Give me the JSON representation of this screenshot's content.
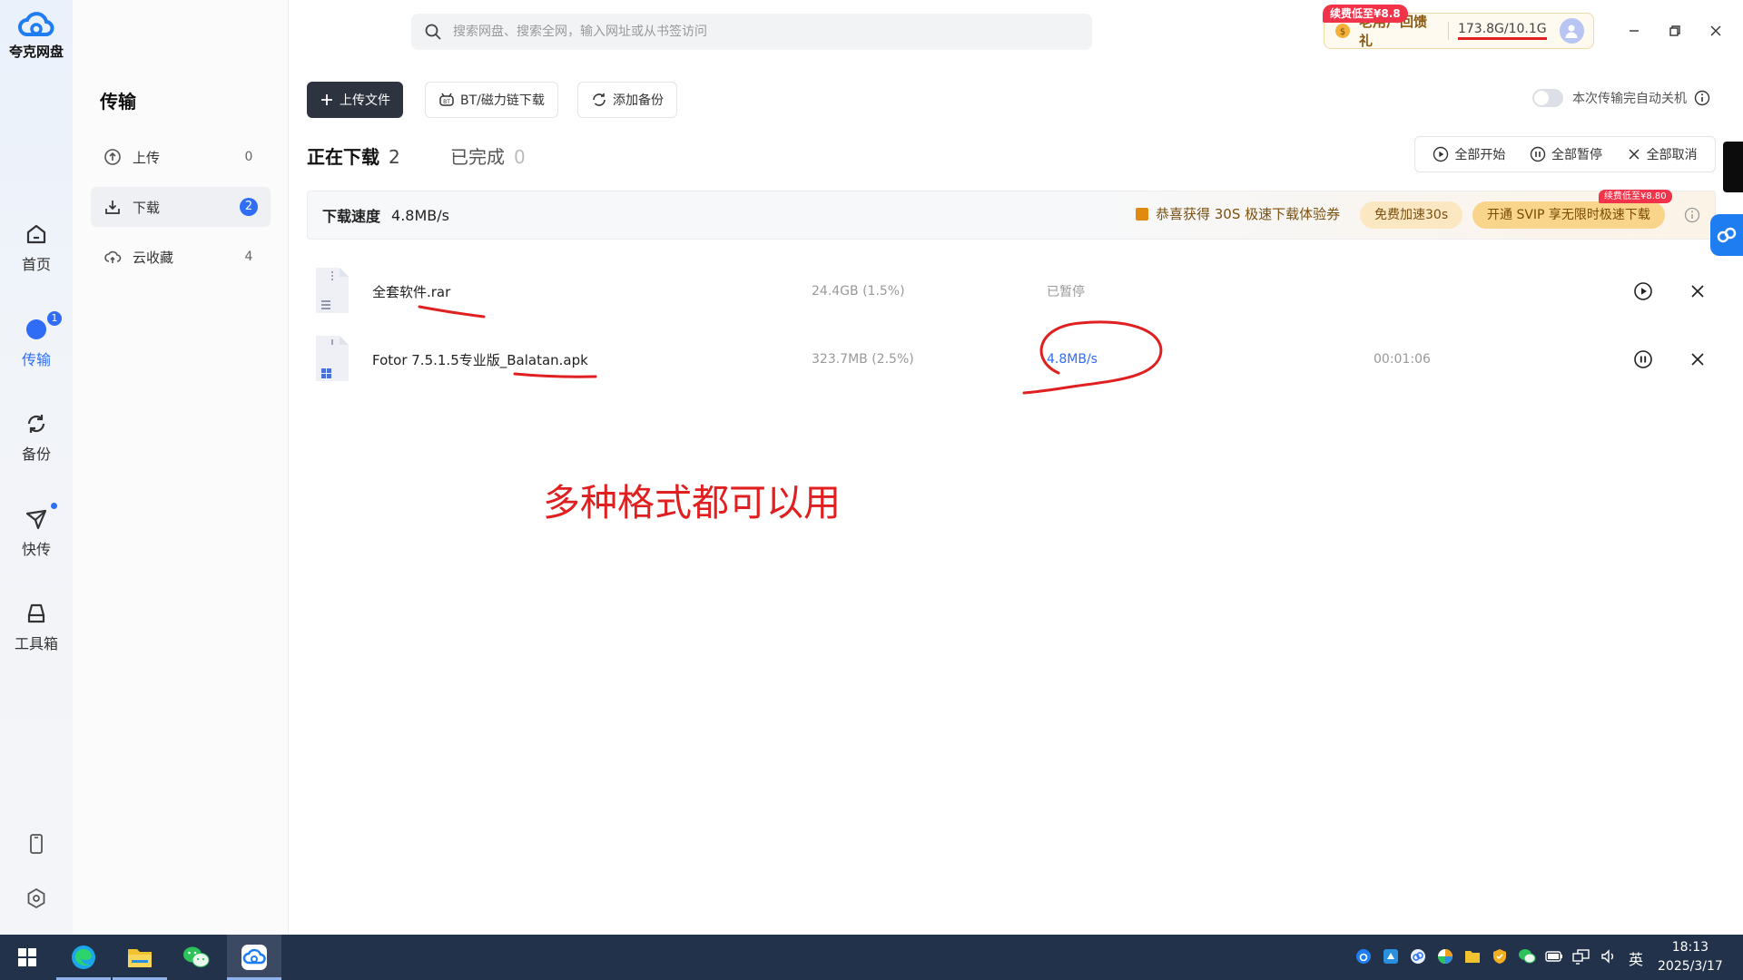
{
  "app": {
    "name": "夸克网盘"
  },
  "nav": {
    "home": "首页",
    "transfer": "传输",
    "transfer_badge": "1",
    "backup": "备份",
    "quick_send": "快传",
    "toolbox": "工具箱"
  },
  "subnav": {
    "title": "传输",
    "items": [
      {
        "label": "上传",
        "count": "0"
      },
      {
        "label": "下载",
        "count": "2"
      },
      {
        "label": "云收藏",
        "count": "4"
      }
    ]
  },
  "search": {
    "placeholder": "搜索网盘、搜索全网，输入网址或从书签访问"
  },
  "promo": {
    "tag": "续费低至¥8.8",
    "gift": "老用户回馈礼",
    "storage": "173.8G/10.1G"
  },
  "toolbar": {
    "upload": "上传文件",
    "bt": "BT/磁力链下载",
    "backup": "添加备份",
    "auto_shutdown": "本次传输完自动关机"
  },
  "tabs": {
    "downloading": "正在下载",
    "downloading_count": "2",
    "completed": "已完成",
    "completed_count": "0"
  },
  "actions": {
    "start_all": "全部开始",
    "pause_all": "全部暂停",
    "cancel_all": "全部取消"
  },
  "speedbar": {
    "label": "下载速度",
    "value": "4.8MB/s",
    "voucher": "恭喜获得 30S 极速下载体验券",
    "free_boost": "免费加速30s",
    "svip": "开通 SVIP 享无限时极速下载",
    "svip_tag": "续费低至¥8.80"
  },
  "downloads": [
    {
      "name": "全套软件.rar",
      "size": "24.4GB (1.5%)",
      "status": "已暂停",
      "time": ""
    },
    {
      "name": "Fotor 7.5.1.5专业版_Balatan.apk",
      "size": "323.7MB (2.5%)",
      "status": "4.8MB/s",
      "time": "00:01:06"
    }
  ],
  "annotation": {
    "text": "多种格式都可以用"
  },
  "taskbar": {
    "time": "18:13",
    "date": "2025/3/17",
    "ime": "英"
  },
  "colors": {
    "accent": "#2f6df6",
    "annotation": "#e02020",
    "promo_red": "#f2334a"
  }
}
